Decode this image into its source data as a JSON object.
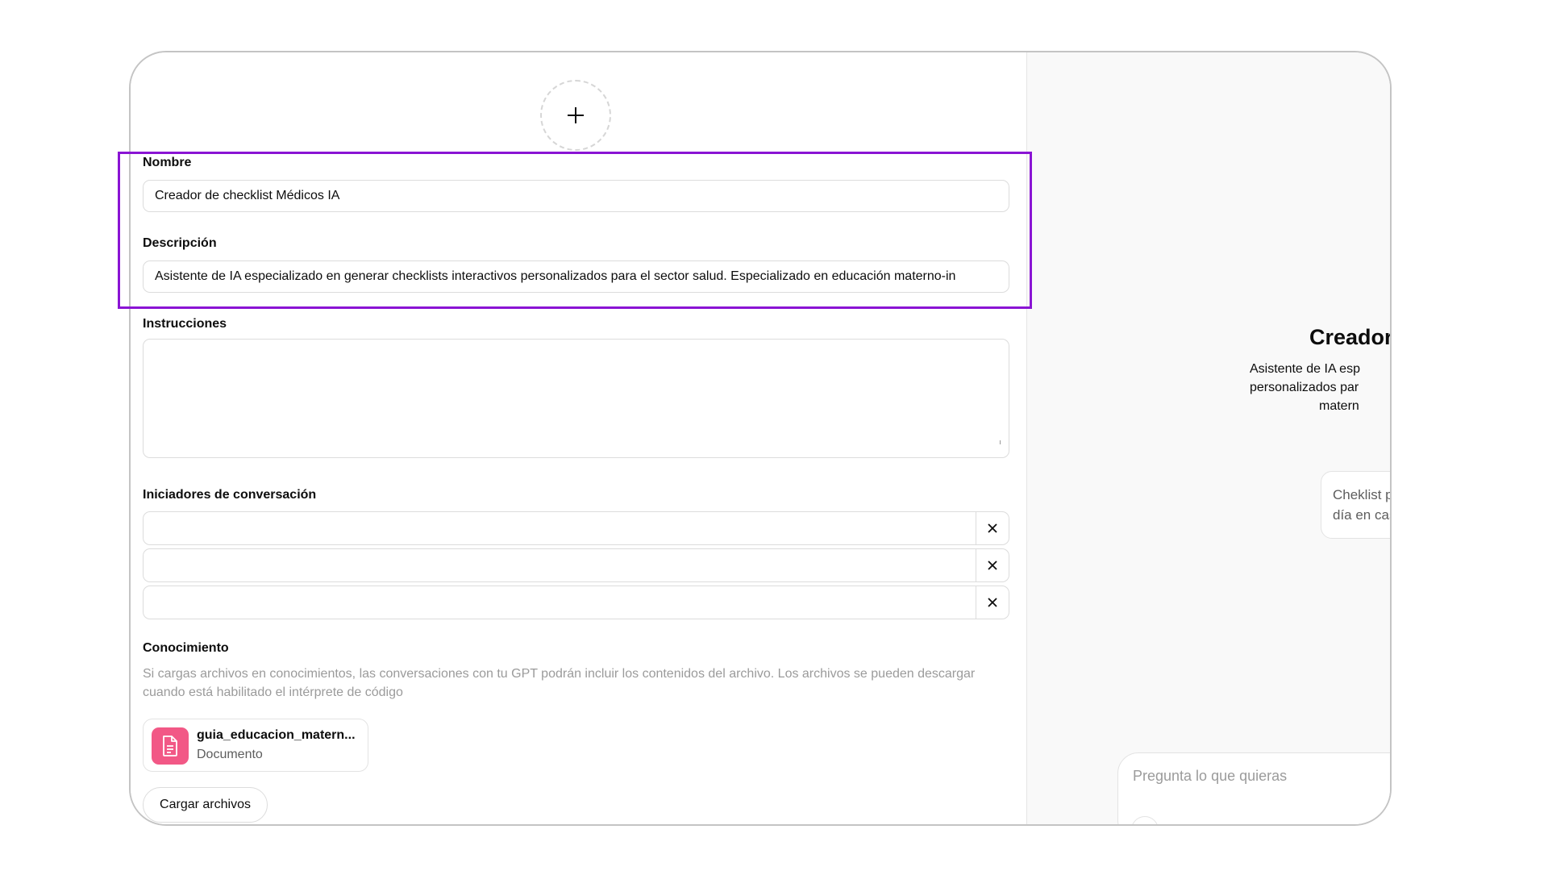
{
  "editor": {
    "avatar_icon": "plus-icon",
    "name_label": "Nombre",
    "name_value": "Creador de checklist Médicos IA",
    "description_label": "Descripción",
    "description_value": "Asistente de IA especializado en generar checklists interactivos personalizados para el sector salud. Especializado en educación materno-in",
    "instructions_label": "Instrucciones",
    "instructions_value": "",
    "starters_label": "Iniciadores de conversación",
    "starters": [
      "",
      "",
      ""
    ],
    "knowledge_label": "Conocimiento",
    "knowledge_description": "Si cargas archivos en conocimientos, las conversaciones con tu GPT podrán incluir los contenidos del archivo. Los archivos se pueden descargar cuando está habilitado el intérprete de código",
    "file": {
      "name": "guia_educacion_matern...",
      "type": "Documento",
      "icon_color": "#f25886"
    },
    "upload_label": "Cargar archivos"
  },
  "preview": {
    "title": "Creador",
    "description_lines": [
      "Asistente de IA esp",
      "personalizados par",
      "matern"
    ],
    "starter_chip_lines": [
      "Cheklist p",
      "día en cas"
    ],
    "composer_placeholder": "Pregunta lo que quieras"
  },
  "highlight_color": "#8a14d4"
}
